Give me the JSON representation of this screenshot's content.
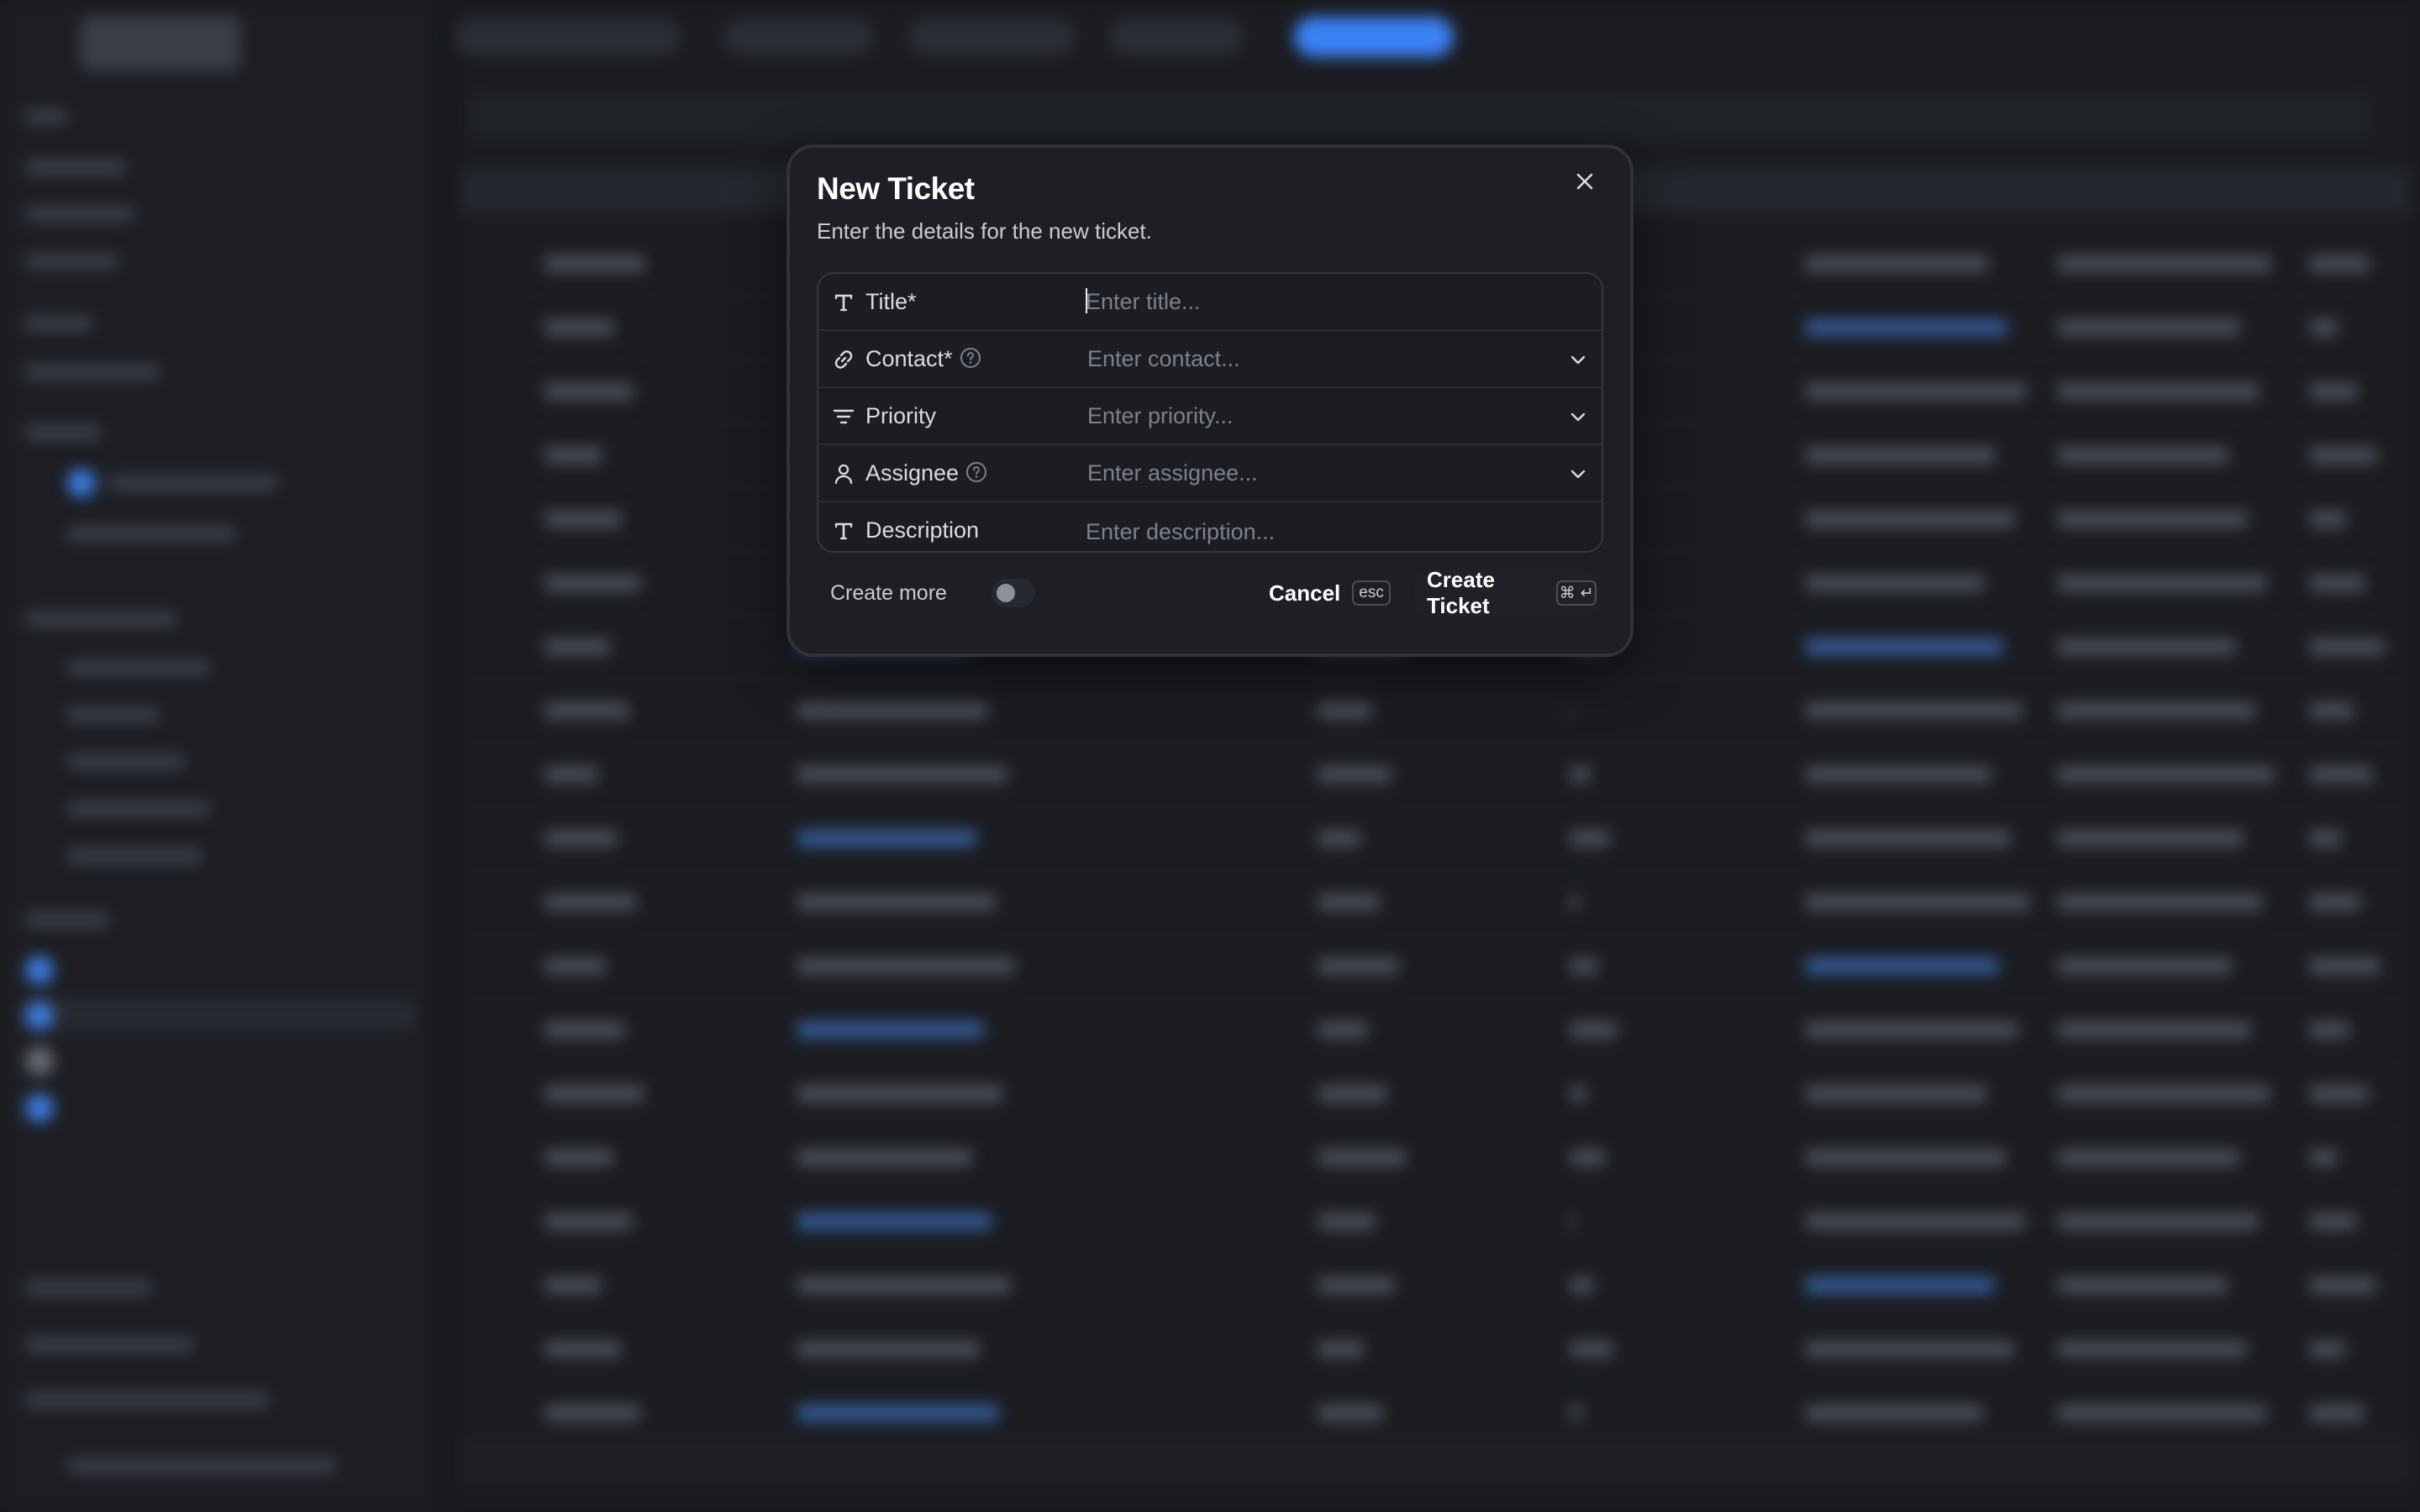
{
  "modal": {
    "title": "New Ticket",
    "subtitle": "Enter the details for the new ticket.",
    "fields": [
      {
        "label": "Title*",
        "placeholder": "Enter title...",
        "icon": "text-t-icon"
      },
      {
        "label": "Contact*",
        "placeholder": "Enter contact...",
        "icon": "link-icon",
        "has_help": true,
        "has_dropdown": true
      },
      {
        "label": "Priority",
        "placeholder": "Enter priority...",
        "icon": "filter-lines-icon",
        "has_dropdown": true
      },
      {
        "label": "Assignee",
        "placeholder": "Enter assignee...",
        "icon": "person-icon",
        "has_help": true,
        "has_dropdown": true
      },
      {
        "label": "Description",
        "placeholder": "Enter description...",
        "icon": "text-t-icon"
      }
    ],
    "footer": {
      "create_more_label": "Create more",
      "create_more_enabled": false,
      "cancel_label": "Cancel",
      "cancel_shortcut": "esc",
      "create_label": "Create Ticket",
      "create_shortcut_cmd": "⌘",
      "create_shortcut_enter": "↵"
    }
  },
  "colors": {
    "background": "#17191d",
    "modal_bg": "#1d1f24",
    "accent_blue": "#3b82f6",
    "placeholder": "#7d818a"
  }
}
